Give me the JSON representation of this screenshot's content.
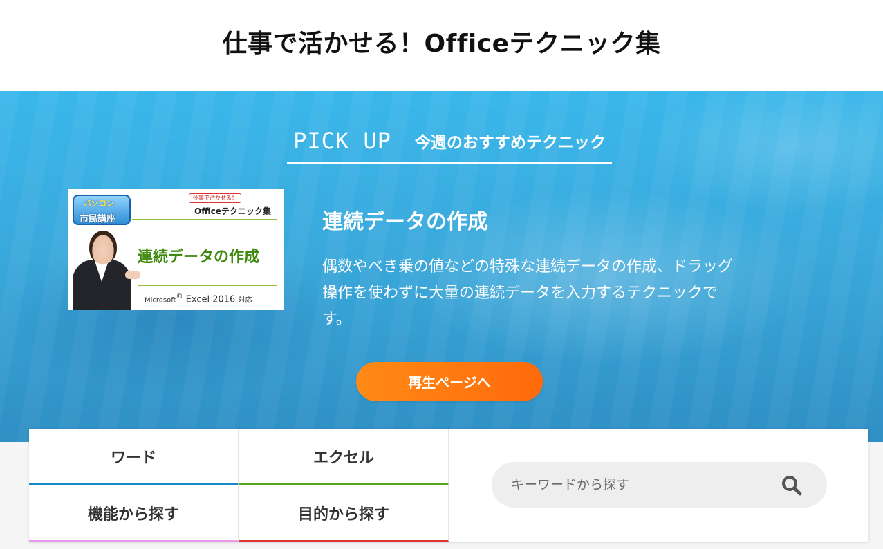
{
  "header": {
    "title": "仕事で活かせる！Officeテクニック集"
  },
  "pickup": {
    "heading_en": "PICK UP",
    "heading_ja": "今週のおすすめテクニック",
    "thumbnail": {
      "logo_top": "パソコン",
      "logo_text": "市民講座",
      "tag": "仕事で活かせる！",
      "series": "Officeテクニック集",
      "title": "連続データの作成",
      "footer_brand": "Microsoft",
      "footer_product": "Excel 2016",
      "footer_suffix": "対応"
    },
    "title": "連続データの作成",
    "description": "偶数やべき乗の値などの特殊な連続データの作成、ドラッグ操作を使わずに大量の連続データを入力するテクニックです。",
    "button_label": "再生ページへ",
    "button_color": "#ff7a10"
  },
  "categories": [
    {
      "label": "ワード",
      "accent": "#1a87c6"
    },
    {
      "label": "エクセル",
      "accent": "#57a51c"
    },
    {
      "label": "機能から探す",
      "accent": "#e79aee"
    },
    {
      "label": "目的から探す",
      "accent": "#e03131"
    }
  ],
  "search": {
    "placeholder": "キーワードから探す",
    "icon": "search-icon"
  }
}
